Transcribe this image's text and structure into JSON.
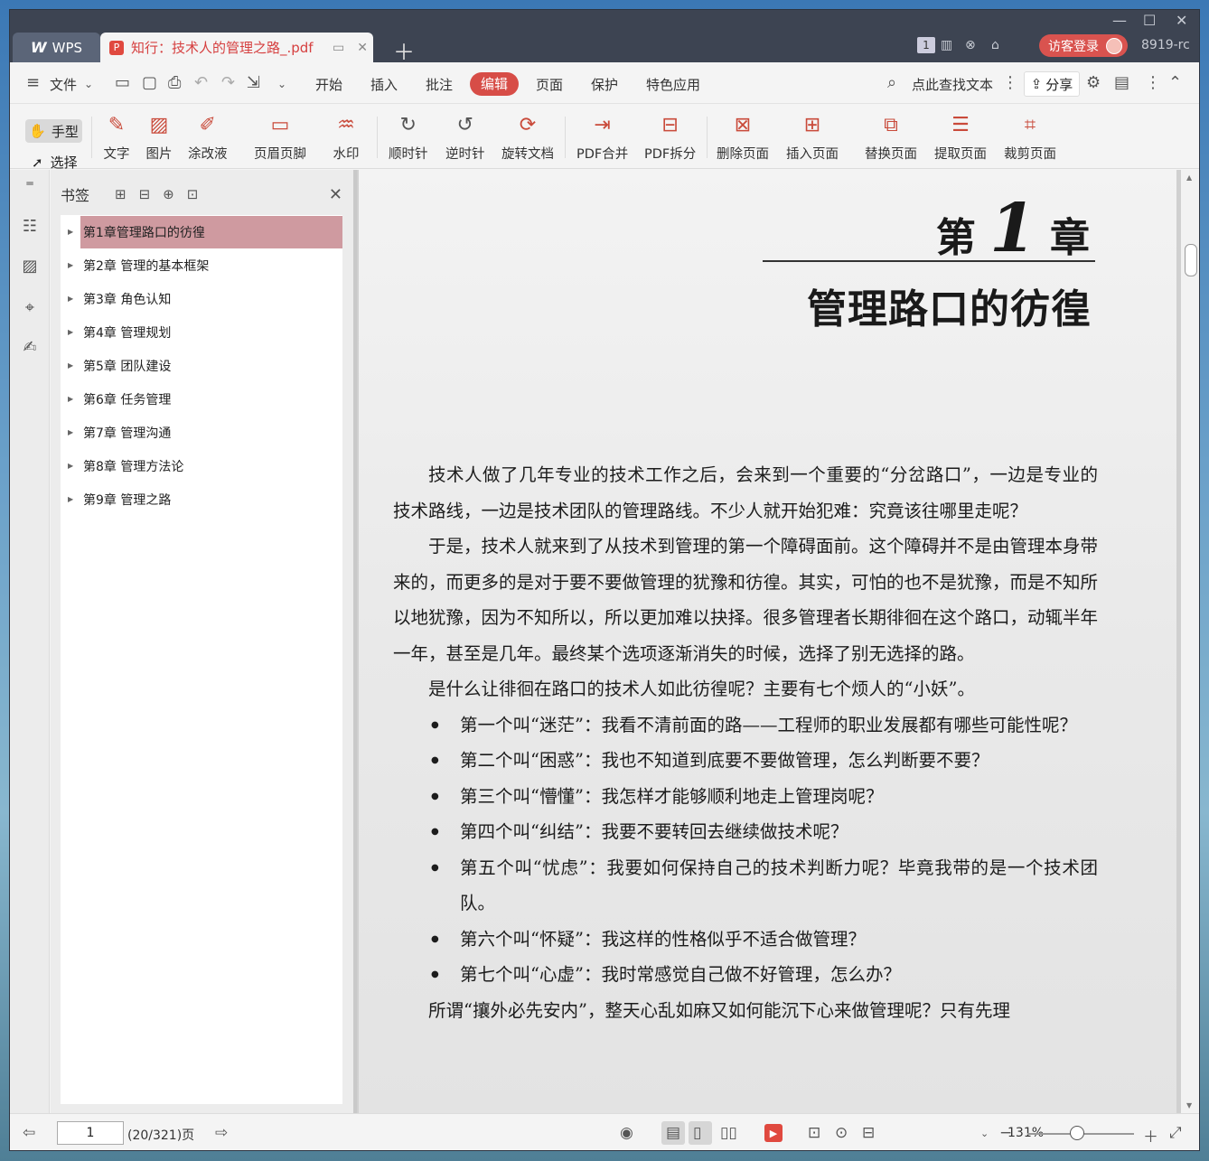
{
  "titlebar": {
    "app_tab": "WPS",
    "doc_tab": "知行：技术人的管理之路_.pdf",
    "page_badge": "1",
    "visitor_label": "访客登录",
    "user_id": "8919-rc"
  },
  "menubar": {
    "file": "文件",
    "items": [
      "开始",
      "插入",
      "批注",
      "编辑",
      "页面",
      "保护",
      "特色应用"
    ],
    "active": "编辑",
    "search": "点此查找文本",
    "share": "分享"
  },
  "ribbon": {
    "hand": "手型",
    "select": "选择",
    "buttons": [
      "文字",
      "图片",
      "涂改液",
      "页眉页脚",
      "水印",
      "顺时针",
      "逆时针",
      "旋转文档",
      "PDF合并",
      "PDF拆分",
      "删除页面",
      "插入页面",
      "替换页面",
      "提取页面",
      "裁剪页面"
    ]
  },
  "bookmarks": {
    "title": "书签",
    "items": [
      {
        "label": "第1章管理路口的彷徨"
      },
      {
        "label": "第2章 管理的基本框架"
      },
      {
        "label": "第3章 角色认知"
      },
      {
        "label": "第4章 管理规划"
      },
      {
        "label": "第5章 团队建设"
      },
      {
        "label": "第6章 任务管理"
      },
      {
        "label": "第7章 管理沟通"
      },
      {
        "label": "第8章 管理方法论"
      },
      {
        "label": "第9章 管理之路"
      }
    ]
  },
  "document": {
    "chapter_prefix": "第",
    "chapter_number": "1",
    "chapter_suffix": "章",
    "chapter_title": "管理路口的彷徨",
    "paragraphs": [
      "技术人做了几年专业的技术工作之后，会来到一个重要的“分岔路口”，一边是专业的技术路线，一边是技术团队的管理路线。不少人就开始犯难：究竟该往哪里走呢？",
      "于是，技术人就来到了从技术到管理的第一个障碍面前。这个障碍并不是由管理本身带来的，而更多的是对于要不要做管理的犹豫和彷徨。其实，可怕的也不是犹豫，而是不知所以地犹豫，因为不知所以，所以更加难以抉择。很多管理者长期徘徊在这个路口，动辄半年一年，甚至是几年。最终某个选项逐渐消失的时候，选择了别无选择的路。",
      "是什么让徘徊在路口的技术人如此彷徨呢？主要有七个烦人的“小妖”。"
    ],
    "bullets": [
      "第一个叫“迷茫”：我看不清前面的路——工程师的职业发展都有哪些可能性呢？",
      "第二个叫“困惑”：我也不知道到底要不要做管理，怎么判断要不要？",
      "第三个叫“懵懂”：我怎样才能够顺利地走上管理岗呢？",
      "第四个叫“纠结”：我要不要转回去继续做技术呢？",
      "第五个叫“忧虑”：我要如何保持自己的技术判断力呢？毕竟我带的是一个技术团队。",
      "第六个叫“怀疑”：我这样的性格似乎不适合做管理？",
      "第七个叫“心虚”：我时常感觉自己做不好管理，怎么办？"
    ],
    "last_line": "所谓“攘外必先安内”，整天心乱如麻又如何能沉下心来做管理呢？只有先理"
  },
  "statusbar": {
    "page_input": "1",
    "page_count": "(20/321)页",
    "zoom": "131%"
  },
  "colors": {
    "accent": "#d74d47",
    "titlebar": "#3d4452",
    "bookmark_highlight": "#cf9aa0"
  }
}
